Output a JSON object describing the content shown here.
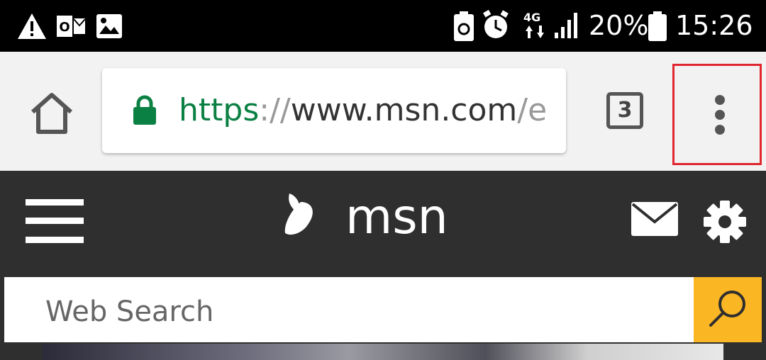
{
  "status_bar": {
    "notification_icons": [
      "warning-icon",
      "outlook-icon",
      "gallery-icon"
    ],
    "system_icons": [
      "battery-saver-icon",
      "alarm-icon",
      "4g-data-icon",
      "signal-icon"
    ],
    "network_label": "4G",
    "battery_percent": "20%",
    "time": "15:26"
  },
  "browser": {
    "url_scheme": "https",
    "url_separator": "://",
    "url_host": "www.msn.com",
    "url_path": "/e",
    "tab_count": "3",
    "colors": {
      "secure": "#0b8043",
      "highlight": "#e0262e"
    }
  },
  "msn_header": {
    "logo_text": "msn",
    "icons": [
      "menu-icon",
      "butterfly-icon",
      "mail-icon",
      "settings-icon"
    ]
  },
  "search": {
    "placeholder": "Web Search",
    "button_icon": "search-icon",
    "accent": "#fbb624"
  }
}
